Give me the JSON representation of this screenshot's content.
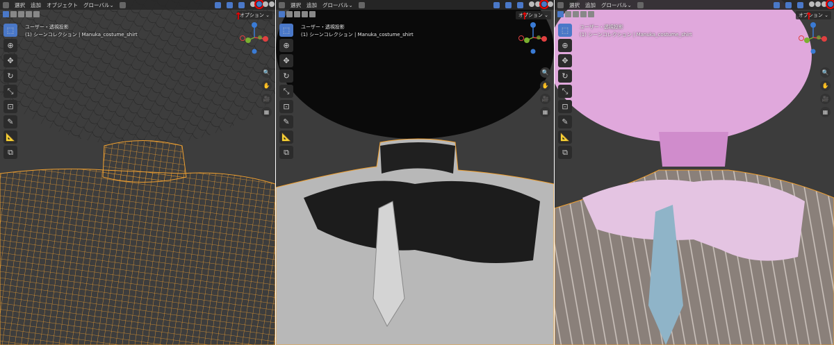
{
  "menu": {
    "select": "選択",
    "add": "追加",
    "object": "オブジェクト",
    "orientation": "グローバル",
    "options": "オプション"
  },
  "overlay": {
    "view": "ユーザー・透視投影",
    "collection": "(1) シーンコレクション | Manuka_costume_shirt"
  },
  "panels": [
    {
      "mode": "wireframe",
      "active_shading": 1,
      "show_object_menu": true
    },
    {
      "mode": "solid",
      "active_shading": 2,
      "show_object_menu": false
    },
    {
      "mode": "material",
      "active_shading": 3,
      "show_object_menu": false
    }
  ],
  "colors": {
    "accent": "#4a78c8",
    "selection": "#f0a030",
    "highlight": "#ee0000"
  },
  "icons": {
    "arrow": "↑",
    "select": "⬚",
    "cursor": "⊕",
    "move": "✥",
    "rotate": "↻",
    "scale": "⤡",
    "transform": "⊡",
    "annotate": "✎",
    "measure": "📐",
    "add_cube": "⧉",
    "zoom": "🔍",
    "pan": "✋",
    "camera": "🎥",
    "grid": "▦"
  }
}
